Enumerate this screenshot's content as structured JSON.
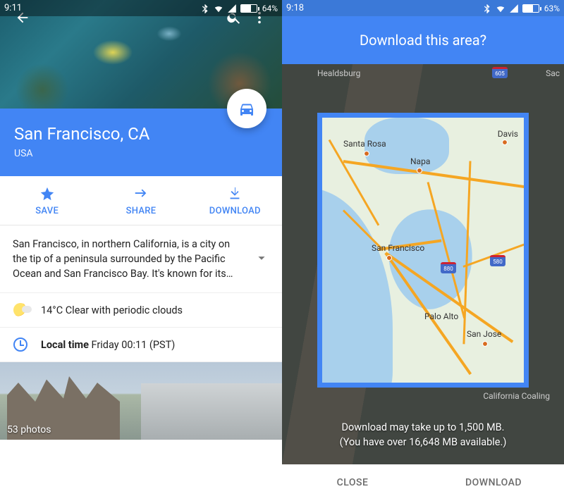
{
  "left": {
    "status": {
      "time": "9:11",
      "battery_pct": "64%",
      "battery_fill": 64
    },
    "place": {
      "name": "San Francisco, CA",
      "country": "USA"
    },
    "actions": {
      "save": "SAVE",
      "share": "SHARE",
      "download": "DOWNLOAD"
    },
    "description": "San Francisco, in northern California, is a city on the tip of a peninsula surrounded by the Pacific Ocean and San Francisco Bay. It's known for its…",
    "weather": "14°C Clear with periodic clouds",
    "local_time_label": "Local time",
    "local_time_value": "Friday 00:11 (PST)",
    "photo_count": "53 photos"
  },
  "right": {
    "status": {
      "time": "9:18",
      "battery_pct": "63%",
      "battery_fill": 63
    },
    "header": "Download this area?",
    "dim_labels": {
      "healdsburg": "Healdsburg",
      "sacramento": "Sac",
      "coalinga": "California Coaling"
    },
    "map_labels": {
      "santa_rosa": "Santa Rosa",
      "napa": "Napa",
      "davis": "Davis",
      "san_francisco": "San Francisco",
      "palo_alto": "Palo Alto",
      "san_jose": "San Jose",
      "i880": "880",
      "i580": "580",
      "i605": "605"
    },
    "caption_line1": "Download may take up to 1,500 MB.",
    "caption_line2": "(You have over 16,648 MB available.)",
    "buttons": {
      "close": "CLOSE",
      "download": "DOWNLOAD"
    }
  }
}
